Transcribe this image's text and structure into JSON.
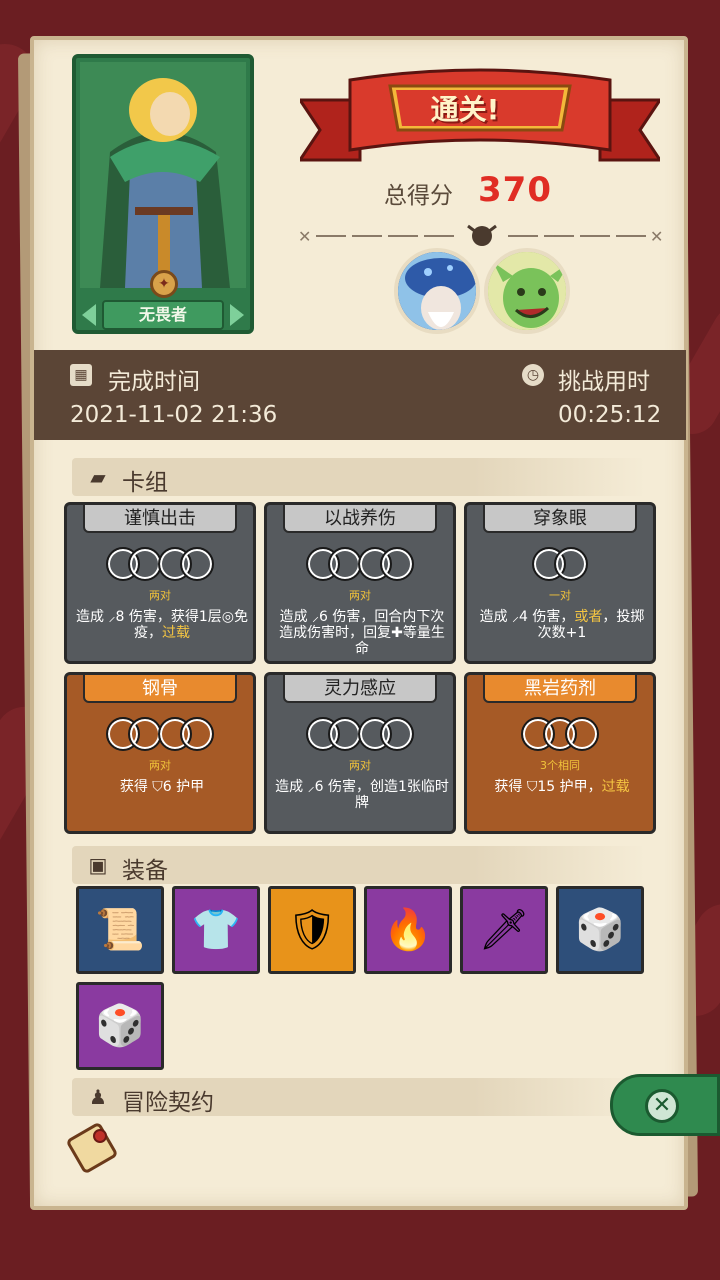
{
  "hero": {
    "name": "无畏者"
  },
  "result": {
    "banner": "通关!",
    "score_label": "总得分",
    "score": "370"
  },
  "times": {
    "finish_label": "完成时间",
    "finish_value": "2021-11-02 21:36",
    "duration_label": "挑战用时",
    "duration_value": "00:25:12"
  },
  "sections": {
    "deck": "卡组",
    "equipment": "装备",
    "contract": "冒险契约"
  },
  "cards": [
    {
      "title": "谨慎出击",
      "style": "gray",
      "req": "两对",
      "desc_pre": "造成 ⸝8 伤害，获得1层◎免疫，",
      "desc_hl": "过载",
      "desc_post": ""
    },
    {
      "title": "以战养伤",
      "style": "gray",
      "req": "两对",
      "desc_pre": "造成 ⸝6 伤害，回合内下次造成伤害时，回复✚等量生命",
      "desc_hl": "",
      "desc_post": ""
    },
    {
      "title": "穿象眼",
      "style": "gray",
      "req": "一对",
      "desc_pre": "造成 ⸝4 伤害，",
      "desc_hl": "或者",
      "desc_post": "，投掷次数+1"
    },
    {
      "title": "钢骨",
      "style": "orange",
      "req": "两对",
      "desc_pre": "获得 ⛉6 护甲",
      "desc_hl": "",
      "desc_post": ""
    },
    {
      "title": "灵力感应",
      "style": "gray",
      "req": "两对",
      "desc_pre": "造成 ⸝6 伤害，创造1张临时牌",
      "desc_hl": "",
      "desc_post": ""
    },
    {
      "title": "黑岩药剂",
      "style": "orange",
      "req": "3个相同",
      "desc_pre": "获得 ⛉15 护甲，",
      "desc_hl": "过载",
      "desc_post": ""
    }
  ],
  "equipment": [
    {
      "icon": "scroll-icon",
      "glyph": "📜",
      "bg": "#2e4f7a"
    },
    {
      "icon": "tunic-icon",
      "glyph": "👕",
      "bg": "#8a3aa0"
    },
    {
      "icon": "ice-shield-icon",
      "glyph": "🛡",
      "bg": "#e8931a"
    },
    {
      "icon": "fire-potion-icon",
      "glyph": "🔥",
      "bg": "#8a3aa0"
    },
    {
      "icon": "dagger-icon",
      "glyph": "🗡",
      "bg": "#8a3aa0"
    },
    {
      "icon": "dice-box-icon",
      "glyph": "🎲",
      "bg": "#2e4f7a"
    },
    {
      "icon": "shadow-dice-icon",
      "glyph": "🎲",
      "bg": "#8a3aa0"
    }
  ],
  "colors": {
    "score": "#e02d24",
    "banner": "#d93a2c",
    "paper": "#f5ecd6",
    "time_bar": "#5b4536"
  }
}
